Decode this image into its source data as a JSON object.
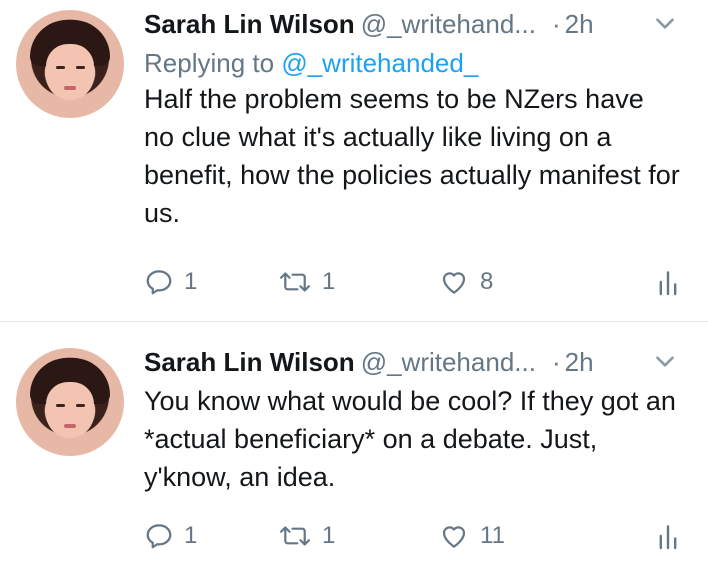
{
  "tweets": [
    {
      "display_name": "Sarah Lin Wilson",
      "handle": "@_writehand...",
      "separator": "·",
      "time": "2h",
      "reply_prefix": "Replying to",
      "reply_mention": "@_writehanded_",
      "text": "Half the problem seems to be NZers have no clue what it's actually like living on a benefit, how the policies actually manifest for us.",
      "replies": "1",
      "retweets": "1",
      "likes": "8"
    },
    {
      "display_name": "Sarah Lin Wilson",
      "handle": "@_writehand...",
      "separator": "·",
      "time": "2h",
      "text": "You know what would be cool? If they got an *actual beneficiary* on a debate. Just, y'know, an idea.",
      "replies": "1",
      "retweets": "1",
      "likes": "11"
    }
  ],
  "icons": {
    "reply": "reply-icon",
    "retweet": "retweet-icon",
    "like": "heart-icon",
    "stats": "analytics-icon",
    "caret": "chevron-down-icon"
  },
  "colors": {
    "text": "#14171a",
    "secondary": "#657786",
    "link": "#1da1f2",
    "divider": "#e1e8ed"
  }
}
